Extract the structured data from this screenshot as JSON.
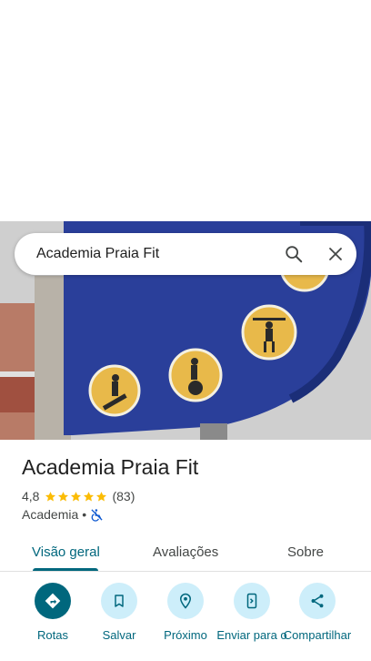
{
  "search": {
    "query": "Academia Praia Fit"
  },
  "place": {
    "name": "Academia Praia Fit",
    "rating": "4,8",
    "rating_value": 4.8,
    "review_count": "(83)",
    "category": "Academia",
    "separator": "•"
  },
  "tabs": [
    {
      "label": "Visão geral",
      "active": true
    },
    {
      "label": "Avaliações",
      "active": false
    },
    {
      "label": "Sobre",
      "active": false
    }
  ],
  "actions": [
    {
      "label": "Rotas",
      "icon": "directions-icon"
    },
    {
      "label": "Salvar",
      "icon": "bookmark-icon"
    },
    {
      "label": "Próximo",
      "icon": "nearby-icon"
    },
    {
      "label": "Enviar para o",
      "icon": "send-to-phone-icon"
    },
    {
      "label": "Compartilhar",
      "icon": "share-icon"
    }
  ],
  "colors": {
    "accent": "#00677d",
    "action_bg": "#cdeefa",
    "star": "#fbbc04",
    "sign_blue": "#2a3f9a",
    "icon_yellow": "#e8b94a"
  }
}
